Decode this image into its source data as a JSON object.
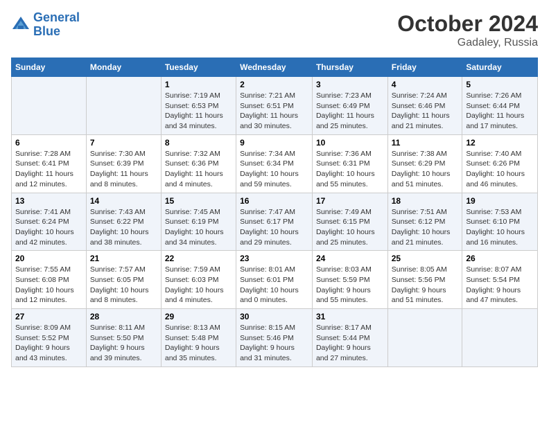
{
  "header": {
    "logo_line1": "General",
    "logo_line2": "Blue",
    "title": "October 2024",
    "subtitle": "Gadaley, Russia"
  },
  "weekdays": [
    "Sunday",
    "Monday",
    "Tuesday",
    "Wednesday",
    "Thursday",
    "Friday",
    "Saturday"
  ],
  "weeks": [
    [
      {
        "day": "",
        "sunrise": "",
        "sunset": "",
        "daylight": ""
      },
      {
        "day": "",
        "sunrise": "",
        "sunset": "",
        "daylight": ""
      },
      {
        "day": "1",
        "sunrise": "Sunrise: 7:19 AM",
        "sunset": "Sunset: 6:53 PM",
        "daylight": "Daylight: 11 hours and 34 minutes."
      },
      {
        "day": "2",
        "sunrise": "Sunrise: 7:21 AM",
        "sunset": "Sunset: 6:51 PM",
        "daylight": "Daylight: 11 hours and 30 minutes."
      },
      {
        "day": "3",
        "sunrise": "Sunrise: 7:23 AM",
        "sunset": "Sunset: 6:49 PM",
        "daylight": "Daylight: 11 hours and 25 minutes."
      },
      {
        "day": "4",
        "sunrise": "Sunrise: 7:24 AM",
        "sunset": "Sunset: 6:46 PM",
        "daylight": "Daylight: 11 hours and 21 minutes."
      },
      {
        "day": "5",
        "sunrise": "Sunrise: 7:26 AM",
        "sunset": "Sunset: 6:44 PM",
        "daylight": "Daylight: 11 hours and 17 minutes."
      }
    ],
    [
      {
        "day": "6",
        "sunrise": "Sunrise: 7:28 AM",
        "sunset": "Sunset: 6:41 PM",
        "daylight": "Daylight: 11 hours and 12 minutes."
      },
      {
        "day": "7",
        "sunrise": "Sunrise: 7:30 AM",
        "sunset": "Sunset: 6:39 PM",
        "daylight": "Daylight: 11 hours and 8 minutes."
      },
      {
        "day": "8",
        "sunrise": "Sunrise: 7:32 AM",
        "sunset": "Sunset: 6:36 PM",
        "daylight": "Daylight: 11 hours and 4 minutes."
      },
      {
        "day": "9",
        "sunrise": "Sunrise: 7:34 AM",
        "sunset": "Sunset: 6:34 PM",
        "daylight": "Daylight: 10 hours and 59 minutes."
      },
      {
        "day": "10",
        "sunrise": "Sunrise: 7:36 AM",
        "sunset": "Sunset: 6:31 PM",
        "daylight": "Daylight: 10 hours and 55 minutes."
      },
      {
        "day": "11",
        "sunrise": "Sunrise: 7:38 AM",
        "sunset": "Sunset: 6:29 PM",
        "daylight": "Daylight: 10 hours and 51 minutes."
      },
      {
        "day": "12",
        "sunrise": "Sunrise: 7:40 AM",
        "sunset": "Sunset: 6:26 PM",
        "daylight": "Daylight: 10 hours and 46 minutes."
      }
    ],
    [
      {
        "day": "13",
        "sunrise": "Sunrise: 7:41 AM",
        "sunset": "Sunset: 6:24 PM",
        "daylight": "Daylight: 10 hours and 42 minutes."
      },
      {
        "day": "14",
        "sunrise": "Sunrise: 7:43 AM",
        "sunset": "Sunset: 6:22 PM",
        "daylight": "Daylight: 10 hours and 38 minutes."
      },
      {
        "day": "15",
        "sunrise": "Sunrise: 7:45 AM",
        "sunset": "Sunset: 6:19 PM",
        "daylight": "Daylight: 10 hours and 34 minutes."
      },
      {
        "day": "16",
        "sunrise": "Sunrise: 7:47 AM",
        "sunset": "Sunset: 6:17 PM",
        "daylight": "Daylight: 10 hours and 29 minutes."
      },
      {
        "day": "17",
        "sunrise": "Sunrise: 7:49 AM",
        "sunset": "Sunset: 6:15 PM",
        "daylight": "Daylight: 10 hours and 25 minutes."
      },
      {
        "day": "18",
        "sunrise": "Sunrise: 7:51 AM",
        "sunset": "Sunset: 6:12 PM",
        "daylight": "Daylight: 10 hours and 21 minutes."
      },
      {
        "day": "19",
        "sunrise": "Sunrise: 7:53 AM",
        "sunset": "Sunset: 6:10 PM",
        "daylight": "Daylight: 10 hours and 16 minutes."
      }
    ],
    [
      {
        "day": "20",
        "sunrise": "Sunrise: 7:55 AM",
        "sunset": "Sunset: 6:08 PM",
        "daylight": "Daylight: 10 hours and 12 minutes."
      },
      {
        "day": "21",
        "sunrise": "Sunrise: 7:57 AM",
        "sunset": "Sunset: 6:05 PM",
        "daylight": "Daylight: 10 hours and 8 minutes."
      },
      {
        "day": "22",
        "sunrise": "Sunrise: 7:59 AM",
        "sunset": "Sunset: 6:03 PM",
        "daylight": "Daylight: 10 hours and 4 minutes."
      },
      {
        "day": "23",
        "sunrise": "Sunrise: 8:01 AM",
        "sunset": "Sunset: 6:01 PM",
        "daylight": "Daylight: 10 hours and 0 minutes."
      },
      {
        "day": "24",
        "sunrise": "Sunrise: 8:03 AM",
        "sunset": "Sunset: 5:59 PM",
        "daylight": "Daylight: 9 hours and 55 minutes."
      },
      {
        "day": "25",
        "sunrise": "Sunrise: 8:05 AM",
        "sunset": "Sunset: 5:56 PM",
        "daylight": "Daylight: 9 hours and 51 minutes."
      },
      {
        "day": "26",
        "sunrise": "Sunrise: 8:07 AM",
        "sunset": "Sunset: 5:54 PM",
        "daylight": "Daylight: 9 hours and 47 minutes."
      }
    ],
    [
      {
        "day": "27",
        "sunrise": "Sunrise: 8:09 AM",
        "sunset": "Sunset: 5:52 PM",
        "daylight": "Daylight: 9 hours and 43 minutes."
      },
      {
        "day": "28",
        "sunrise": "Sunrise: 8:11 AM",
        "sunset": "Sunset: 5:50 PM",
        "daylight": "Daylight: 9 hours and 39 minutes."
      },
      {
        "day": "29",
        "sunrise": "Sunrise: 8:13 AM",
        "sunset": "Sunset: 5:48 PM",
        "daylight": "Daylight: 9 hours and 35 minutes."
      },
      {
        "day": "30",
        "sunrise": "Sunrise: 8:15 AM",
        "sunset": "Sunset: 5:46 PM",
        "daylight": "Daylight: 9 hours and 31 minutes."
      },
      {
        "day": "31",
        "sunrise": "Sunrise: 8:17 AM",
        "sunset": "Sunset: 5:44 PM",
        "daylight": "Daylight: 9 hours and 27 minutes."
      },
      {
        "day": "",
        "sunrise": "",
        "sunset": "",
        "daylight": ""
      },
      {
        "day": "",
        "sunrise": "",
        "sunset": "",
        "daylight": ""
      }
    ]
  ]
}
